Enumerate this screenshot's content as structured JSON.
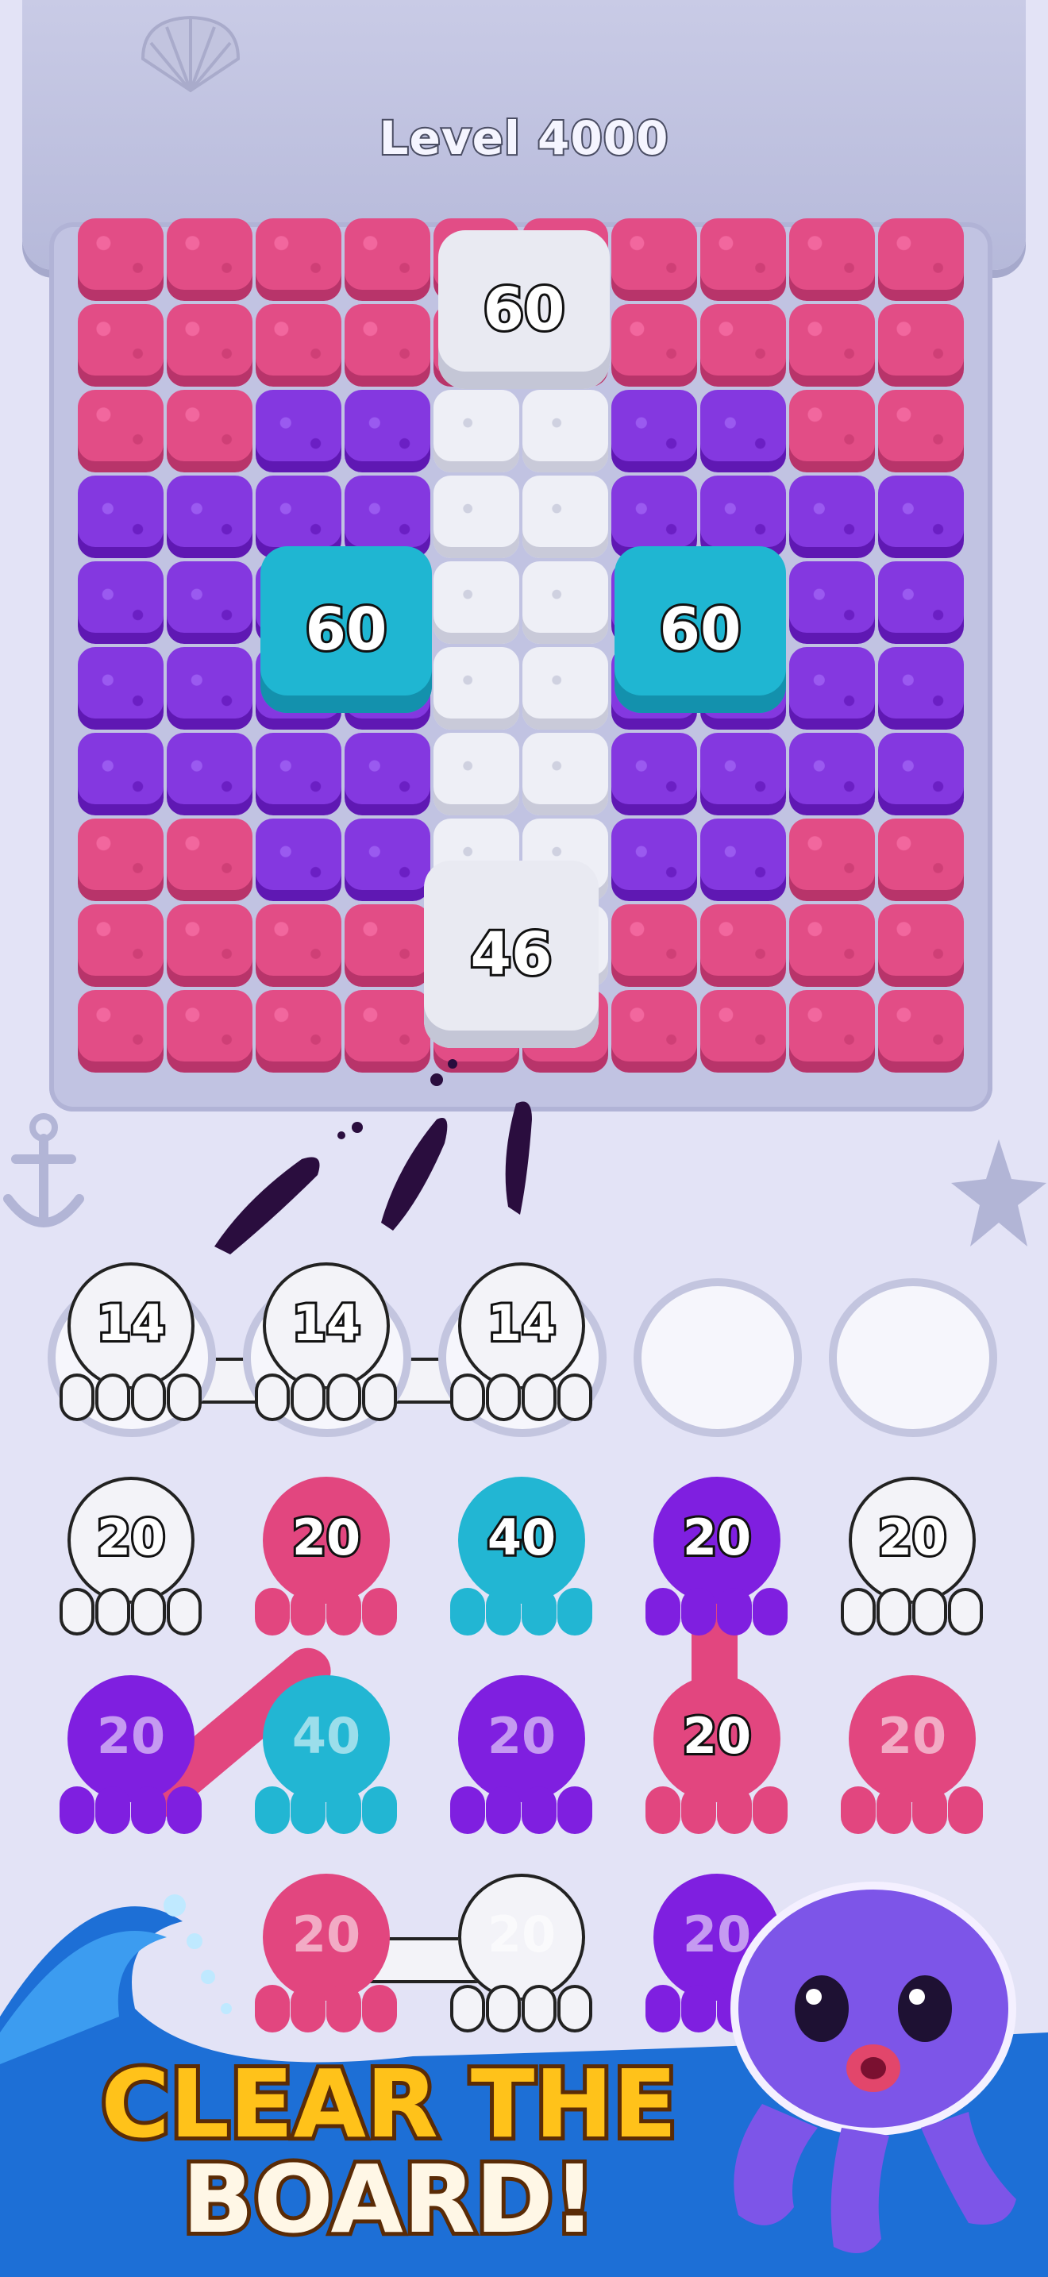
{
  "level_label": "Level 4000",
  "board": {
    "blocks": [
      {
        "value": "60",
        "color": "white"
      },
      {
        "value": "60",
        "color": "cyan"
      },
      {
        "value": "60",
        "color": "cyan"
      },
      {
        "value": "46",
        "color": "white"
      }
    ]
  },
  "holder_slots": [
    {
      "value": "14",
      "color": "white"
    },
    {
      "value": "14",
      "color": "white"
    },
    {
      "value": "14",
      "color": "white"
    },
    {
      "value": "",
      "color": "empty"
    },
    {
      "value": "",
      "color": "empty"
    }
  ],
  "octopus_rows": [
    [
      {
        "value": "20",
        "color": "white"
      },
      {
        "value": "20",
        "color": "pink"
      },
      {
        "value": "40",
        "color": "cyan"
      },
      {
        "value": "20",
        "color": "purple"
      },
      {
        "value": "20",
        "color": "white"
      }
    ],
    [
      {
        "value": "20",
        "color": "purple"
      },
      {
        "value": "40",
        "color": "cyan"
      },
      {
        "value": "20",
        "color": "purple"
      },
      {
        "value": "20",
        "color": "pink"
      },
      {
        "value": "20",
        "color": "pink"
      }
    ],
    [
      {
        "value": "20",
        "color": "pink"
      },
      {
        "value": "20",
        "color": "white"
      },
      {
        "value": "20",
        "color": "purple"
      }
    ]
  ],
  "banner": {
    "line1": "CLEAR THE",
    "line2": "BOARD!"
  },
  "colors": {
    "pink": "#e24d86",
    "purple": "#8438e0",
    "cyan": "#1fb6d2",
    "white": "#eeeff6",
    "headline_yellow": "#ffc21a",
    "wave_blue": "#1d6fd6"
  },
  "icons": [
    "shell-icon",
    "anchor-icon",
    "starfish-icon",
    "octopus-mascot-icon"
  ]
}
